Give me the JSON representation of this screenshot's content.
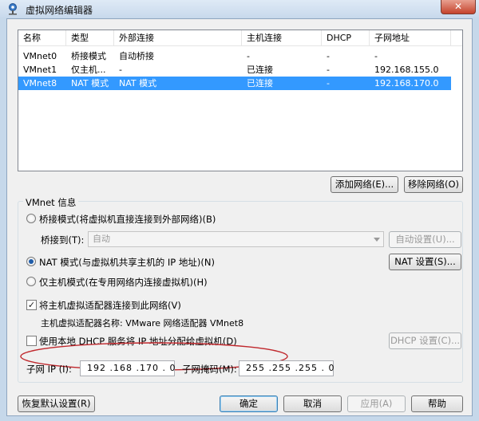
{
  "window": {
    "title": "虚拟网络编辑器",
    "close_label": "✕"
  },
  "list": {
    "headers": [
      "名称",
      "类型",
      "外部连接",
      "主机连接",
      "DHCP",
      "子网地址"
    ],
    "rows": [
      {
        "name": "VMnet0",
        "type": "桥接模式",
        "external": "自动桥接",
        "host": "-",
        "dhcp": "-",
        "subnet": "-"
      },
      {
        "name": "VMnet1",
        "type": "仅主机...",
        "external": "-",
        "host": "已连接",
        "dhcp": "-",
        "subnet": "192.168.155.0"
      },
      {
        "name": "VMnet8",
        "type": "NAT 模式",
        "external": "NAT 模式",
        "host": "已连接",
        "dhcp": "-",
        "subnet": "192.168.170.0"
      }
    ],
    "selected_index": 2
  },
  "buttons": {
    "add_network": "添加网络(E)...",
    "remove_network": "移除网络(O)",
    "auto_settings": "自动设置(U)...",
    "nat_settings": "NAT 设置(S)...",
    "dhcp_settings": "DHCP 设置(C)...",
    "restore_defaults": "恢复默认设置(R)",
    "ok": "确定",
    "cancel": "取消",
    "apply": "应用(A)",
    "help": "帮助"
  },
  "vmnet_info": {
    "legend": "VMnet 信息",
    "bridged_label": "桥接模式(将虚拟机直接连接到外部网络)(B)",
    "bridge_to_label": "桥接到(T):",
    "bridge_to_value": "自动",
    "nat_label": "NAT 模式(与虚拟机共享主机的 IP 地址)(N)",
    "host_only_label": "仅主机模式(在专用网络内连接虚拟机)(H)",
    "selected_mode": "nat",
    "connect_adapter_label": "将主机虚拟适配器连接到此网络(V)",
    "connect_adapter_checked": true,
    "adapter_name_label": "主机虚拟适配器名称: VMware 网络适配器 VMnet8",
    "dhcp_label": "使用本地 DHCP 服务将 IP 地址分配给虚拟机(D)",
    "dhcp_checked": false,
    "subnet_ip_label": "子网 IP (I):",
    "subnet_ip_value": "192 .168 .170 . 0",
    "subnet_mask_label": "子网掩码(M):",
    "subnet_mask_value": "255 .255 .255 . 0"
  },
  "colors": {
    "selection": "#3399ff",
    "annotation": "#c0282d"
  }
}
